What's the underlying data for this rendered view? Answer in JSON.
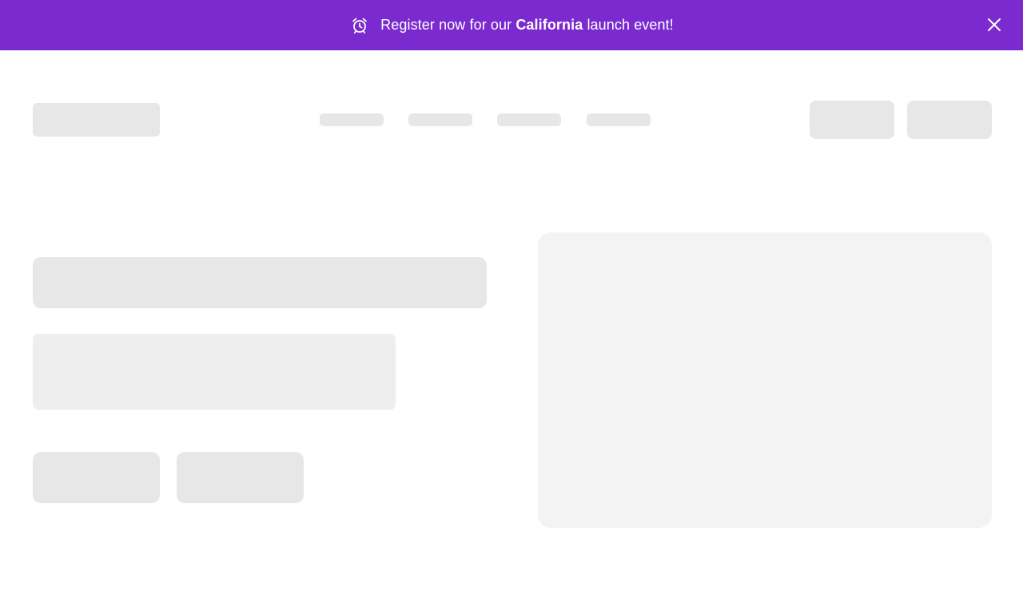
{
  "banner": {
    "text_before": "Register now for our ",
    "text_emphasis": "California",
    "text_after": " launch event!",
    "background_color": "#7b2acf",
    "icon": "alarm-clock-icon",
    "close_icon": "close-icon"
  },
  "placeholder_colors": {
    "default": "#e7e7e7",
    "light": "#eeeeee",
    "lighter": "#f3f3f3"
  }
}
